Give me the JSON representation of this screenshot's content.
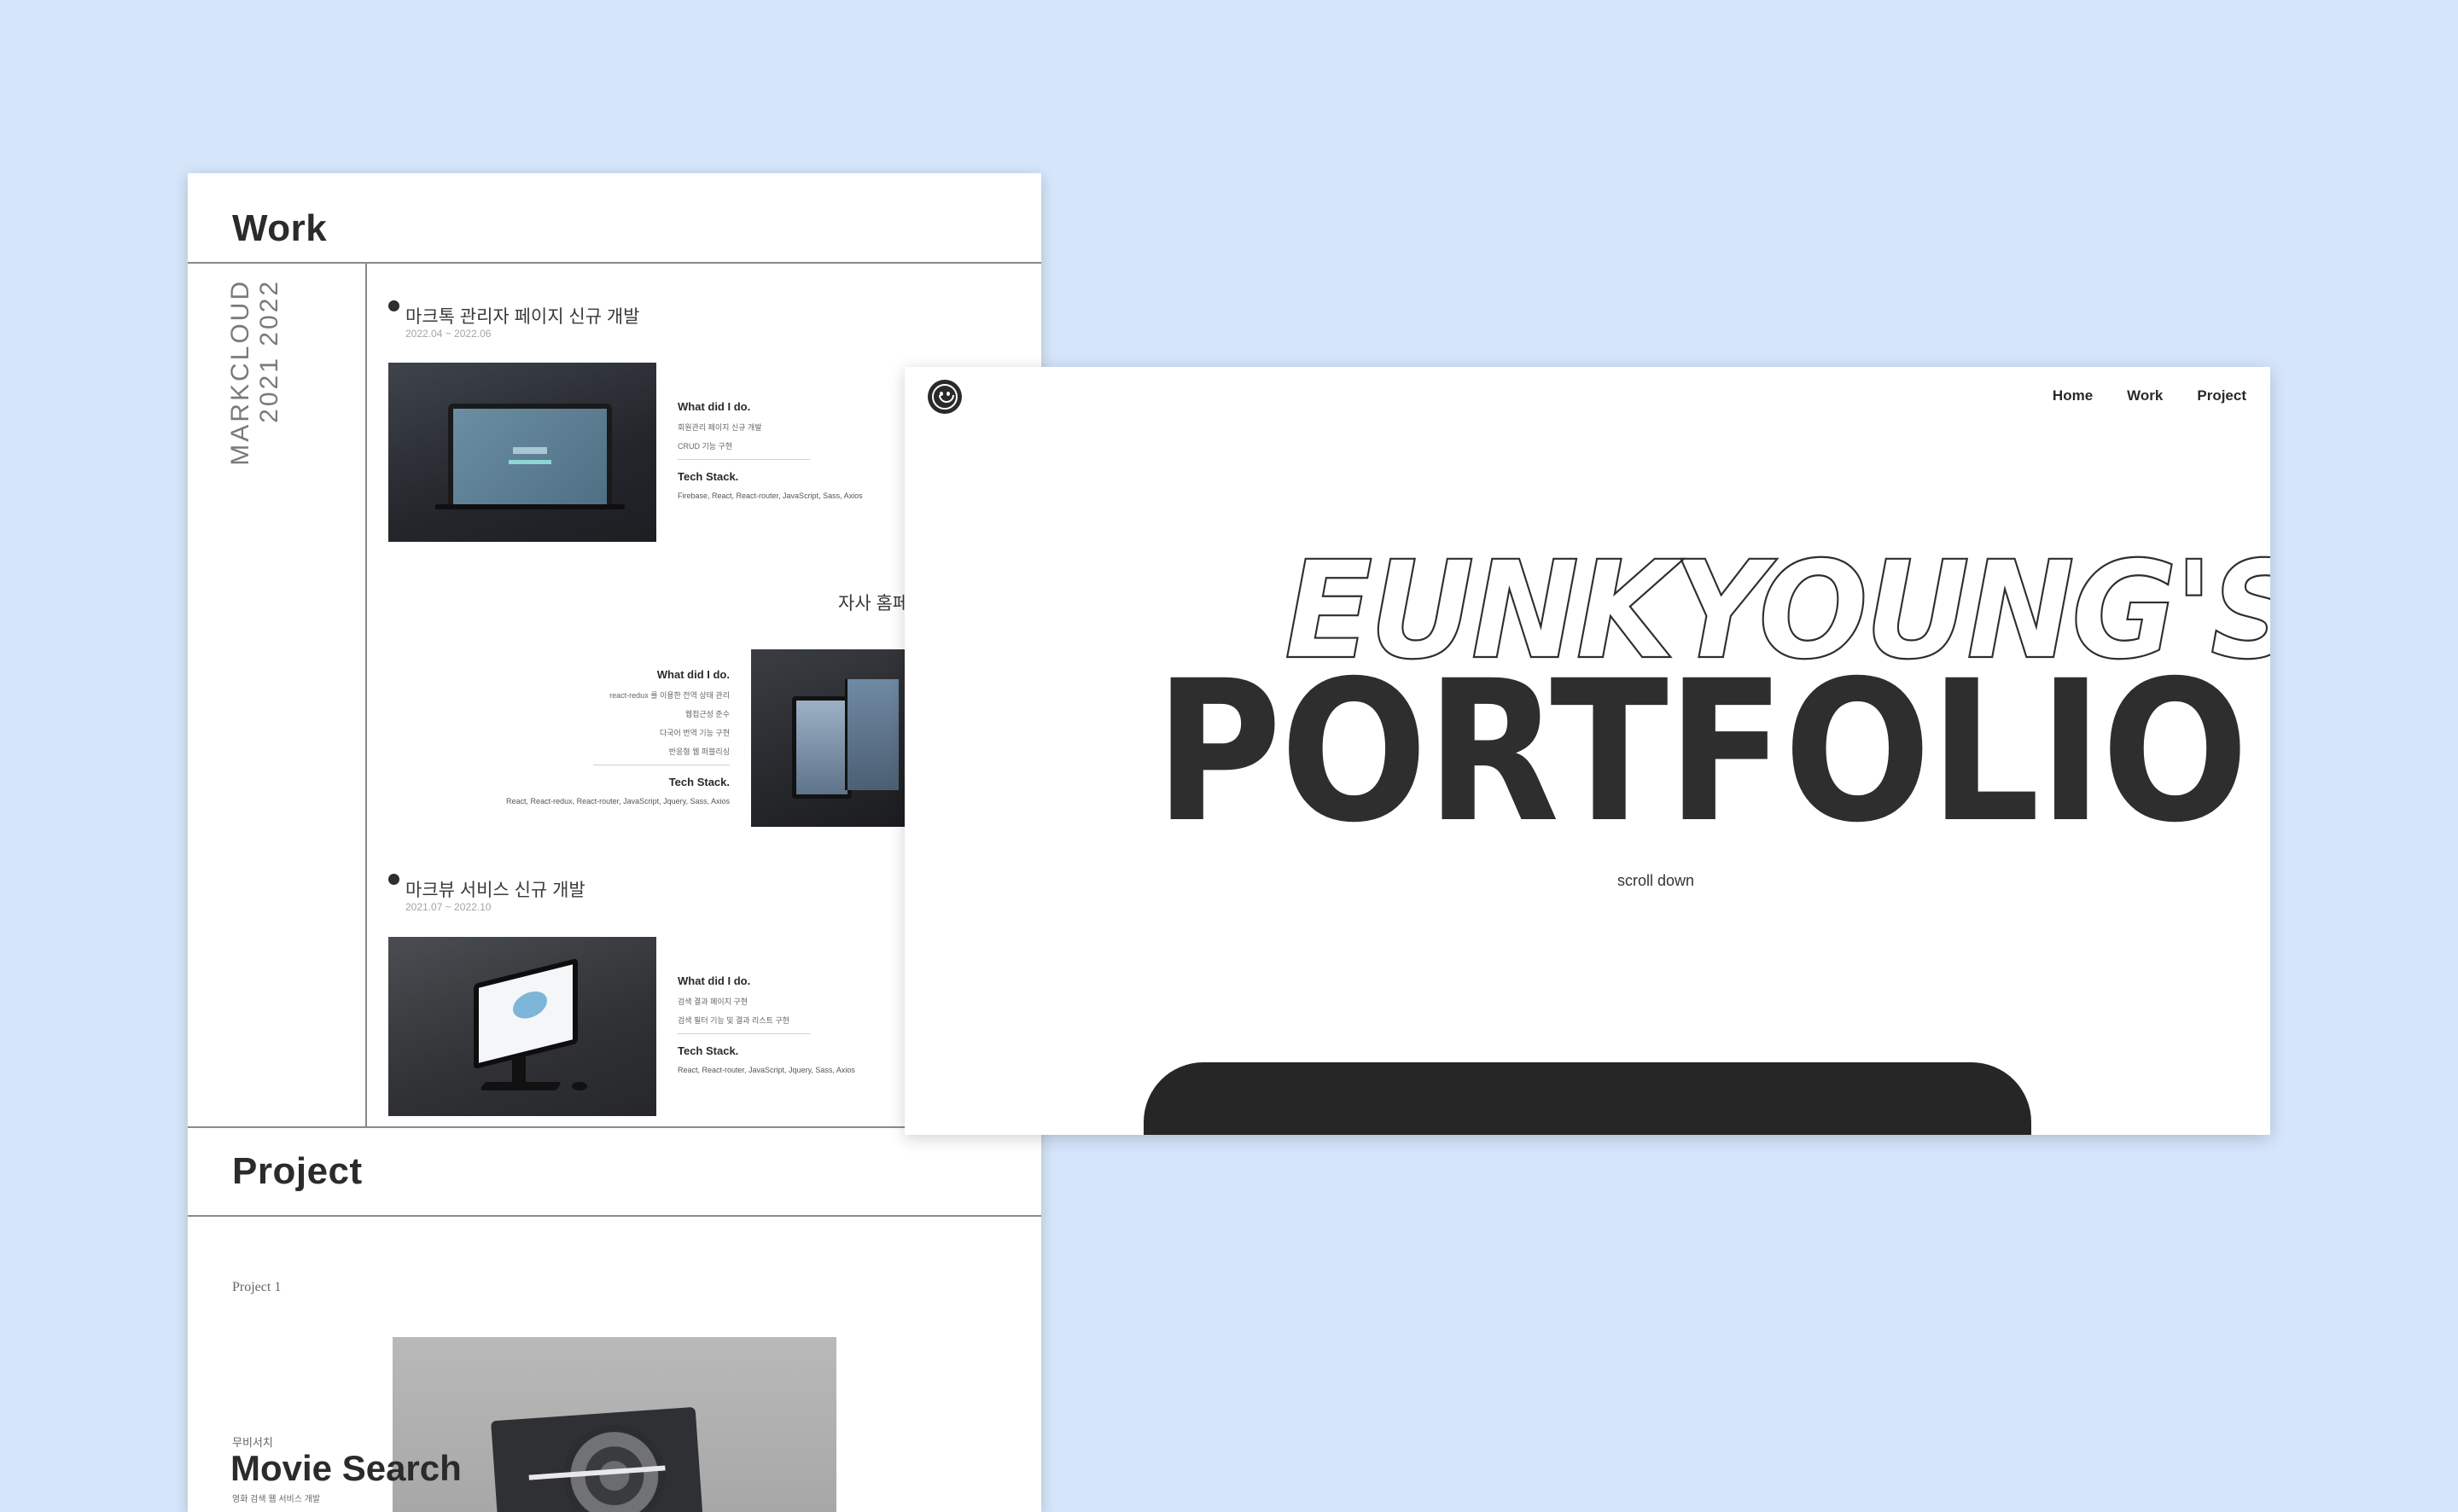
{
  "work": {
    "title": "Work",
    "company": {
      "name": "MARKCLOUD",
      "years": "2021  2022"
    },
    "entries": [
      {
        "title": "마크톡 관리자 페이지 신규 개발",
        "date": "2022.04 ~ 2022.06",
        "what_label": "What did I do.",
        "what_lines": [
          "회원관리 페이지 신규 개발",
          "CRUD 기능 구현"
        ],
        "stack_label": "Tech Stack.",
        "stack": "Firebase, React, React-router, JavaScript, Sass, Axios"
      },
      {
        "title": "자사 홈페",
        "what_label": "What did I do.",
        "what_lines": [
          "react-redux 를 이용한 전역 상태 관리",
          "웹접근성 준수",
          "다국어 번역 기능 구현",
          "반응형 웹 퍼블리싱"
        ],
        "stack_label": "Tech Stack.",
        "stack": "React, React-redux, React-router, JavaScript, Jquery, Sass, Axios"
      },
      {
        "title": "마크뷰 서비스 신규 개발",
        "date": "2021.07 ~ 2022.10",
        "what_label": "What did I do.",
        "what_lines": [
          "검색 결과 페이지 구현",
          "검색 필터 기능 및 결과 리스트 구현"
        ],
        "stack_label": "Tech Stack.",
        "stack": "React, React-router, JavaScript, Jquery, Sass, Axios"
      }
    ]
  },
  "project": {
    "title": "Project",
    "label": "Project 1",
    "kor_title": "무비서치",
    "name": "Movie Search",
    "desc": "영화 검색 웹 서비스 개발"
  },
  "hero": {
    "nav": [
      {
        "label": "Home"
      },
      {
        "label": "Work"
      },
      {
        "label": "Project"
      }
    ],
    "headline_outline": "EUNKYOUNG'S",
    "headline_solid": "PORTFOLIO",
    "scroll_label": "scroll down"
  },
  "colors": {
    "background": "#d5e5fa",
    "ink": "#2e2e2e",
    "card_dark": "#262626"
  },
  "icons": {
    "logo": "smiley-face-icon",
    "bullet": "dot-icon"
  }
}
